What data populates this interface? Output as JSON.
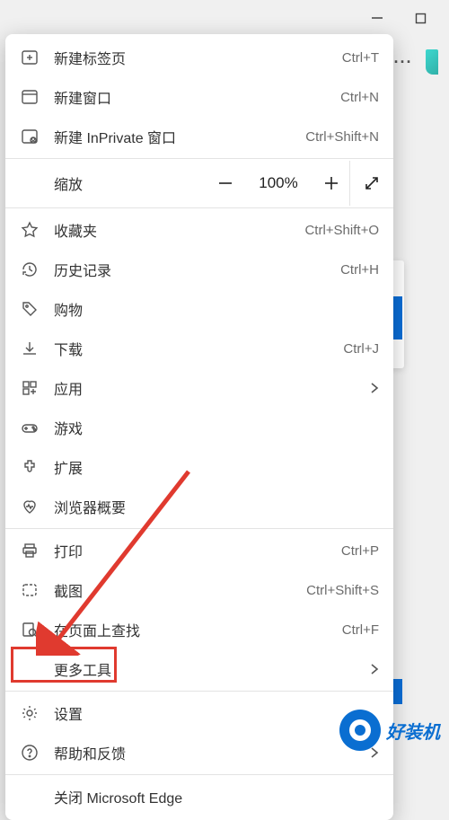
{
  "window": {
    "minimize": "–",
    "maximize": "▢",
    "more": "···"
  },
  "menu": {
    "newTab": {
      "label": "新建标签页",
      "shortcut": "Ctrl+T"
    },
    "newWindow": {
      "label": "新建窗口",
      "shortcut": "Ctrl+N"
    },
    "newInPrivate": {
      "label": "新建 InPrivate 窗口",
      "shortcut": "Ctrl+Shift+N"
    },
    "zoom": {
      "label": "缩放",
      "value": "100%"
    },
    "favorites": {
      "label": "收藏夹",
      "shortcut": "Ctrl+Shift+O"
    },
    "history": {
      "label": "历史记录",
      "shortcut": "Ctrl+H"
    },
    "shopping": {
      "label": "购物"
    },
    "downloads": {
      "label": "下载",
      "shortcut": "Ctrl+J"
    },
    "apps": {
      "label": "应用"
    },
    "games": {
      "label": "游戏"
    },
    "extensions": {
      "label": "扩展"
    },
    "browserEssentials": {
      "label": "浏览器概要"
    },
    "print": {
      "label": "打印",
      "shortcut": "Ctrl+P"
    },
    "screenshot": {
      "label": "截图",
      "shortcut": "Ctrl+Shift+S"
    },
    "findOnPage": {
      "label": "在页面上查找",
      "shortcut": "Ctrl+F"
    },
    "moreTools": {
      "label": "更多工具"
    },
    "settings": {
      "label": "设置"
    },
    "helpFeedback": {
      "label": "帮助和反馈"
    },
    "closeEdge": {
      "label": "关闭 Microsoft Edge"
    }
  },
  "watermark": {
    "text": "好装机"
  }
}
